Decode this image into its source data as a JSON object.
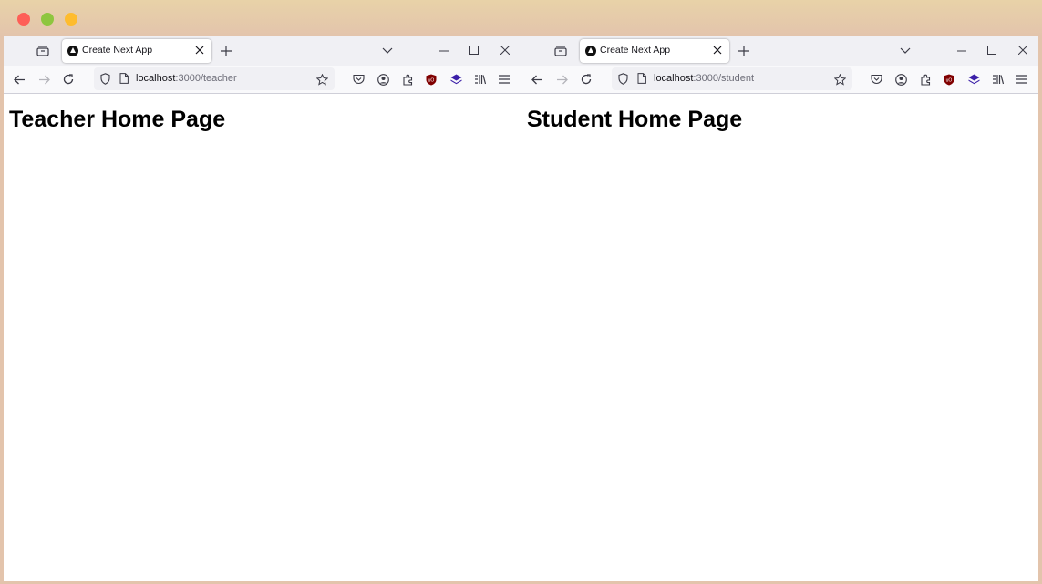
{
  "windows": [
    {
      "tab": {
        "title": "Create Next App"
      },
      "url": {
        "host": "localhost",
        "path": ":3000/teacher"
      },
      "heading": "Teacher Home Page"
    },
    {
      "tab": {
        "title": "Create Next App"
      },
      "url": {
        "host": "localhost",
        "path": ":3000/student"
      },
      "heading": "Student Home Page"
    }
  ],
  "icons": {
    "tab_overview": "tab-overview-icon",
    "new_tab": "plus-icon",
    "list_all_tabs": "chevron-down-icon",
    "minimize": "minimize-icon",
    "maximize": "maximize-icon",
    "close": "close-icon",
    "back": "back-arrow-icon",
    "forward": "forward-arrow-icon",
    "reload": "reload-icon",
    "shield": "shield-icon",
    "page": "page-icon",
    "bookmark": "star-icon",
    "pocket": "pocket-icon",
    "account": "account-icon",
    "extensions": "puzzle-icon",
    "ublock": "ublock-icon",
    "extension_layers": "layers-icon",
    "library": "library-icon",
    "menu": "hamburger-menu-icon"
  },
  "colors": {
    "traffic_red": "#fe5f57",
    "traffic_green": "#8ec63f",
    "traffic_yellow": "#febc2e",
    "ublock_red": "#800000",
    "layers_purple": "#3b1fa8"
  }
}
